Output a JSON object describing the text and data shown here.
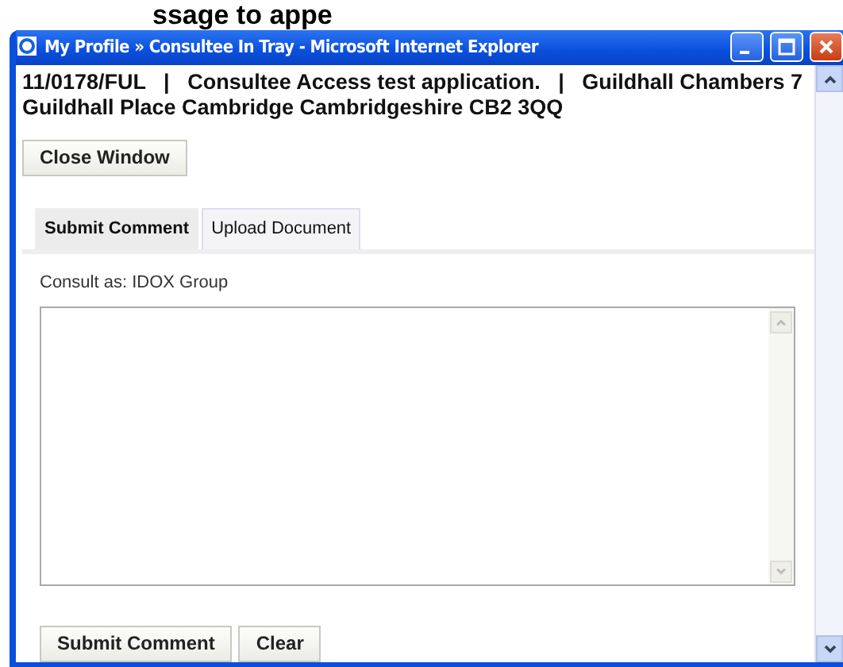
{
  "background": {
    "heading": "ssage to appe"
  },
  "window": {
    "title": "My Profile » Consultee In Tray - Microsoft Internet Explorer"
  },
  "application": {
    "heading": "11/0178/FUL   |   Consultee Access test application.   |   Guildhall Chambers 7 Guildhall Place Cambridge Cambridgeshire CB2 3QQ"
  },
  "close_button": "Close Window",
  "tabs": [
    {
      "label": "Submit Comment",
      "selected": true
    },
    {
      "label": "Upload Document",
      "selected": false
    }
  ],
  "consult_as": "Consult as: IDOX Group",
  "buttons": [
    "Submit Comment",
    "Clear"
  ]
}
